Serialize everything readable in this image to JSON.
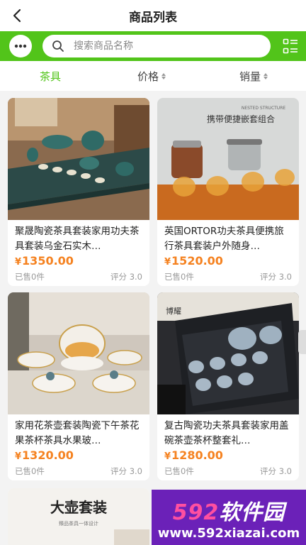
{
  "header": {
    "title": "商品列表"
  },
  "search": {
    "placeholder": "搜索商品名称"
  },
  "sort": {
    "category_label": "茶具",
    "price_label": "价格",
    "sales_label": "销量"
  },
  "products": [
    {
      "name": "聚晟陶瓷茶具套装家用功夫茶具套装乌金石实木…",
      "currency": "¥",
      "price": "1350.00",
      "sold": "已售0件",
      "rating": "评分 3.0"
    },
    {
      "name": "英国ORTOR功夫茶具便携旅行茶具套装户外随身…",
      "currency": "¥",
      "price": "1520.00",
      "sold": "已售0件",
      "rating": "评分 3.0"
    },
    {
      "name": "家用花茶壶套装陶瓷下午茶花果茶杯茶具水果玻…",
      "currency": "¥",
      "price": "1320.00",
      "sold": "已售0件",
      "rating": "评分 3.0"
    },
    {
      "name": "复古陶瓷功夫茶具套装家用盖碗茶壶茶杯整套礼…",
      "currency": "¥",
      "price": "1280.00",
      "sold": "已售0件",
      "rating": "评分 3.0"
    }
  ],
  "images": {
    "img2_caption_en": "NESTED STRUCTURE",
    "img2_caption_cn": "携带便捷嵌套组合",
    "img4_caption": "博耀",
    "img5_caption": "大壶套装",
    "img5_sub": "臻品茶具一体设计"
  },
  "watermark": {
    "brand_prefix": "592",
    "brand_suffix": "软件园",
    "url": "www.592xiazai.com"
  },
  "colors": {
    "accent": "#52c41a",
    "price": "#f58220",
    "watermark": "#6b21b8"
  }
}
